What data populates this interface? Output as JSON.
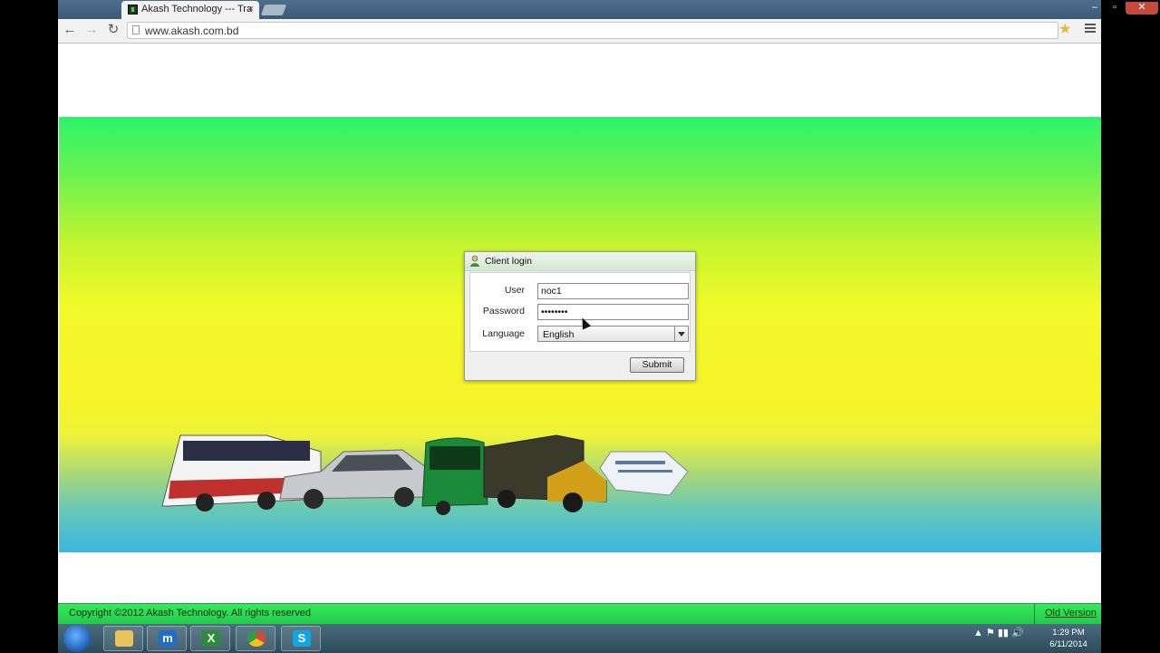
{
  "browser": {
    "tab_title": "Akash Technology --- Tra",
    "tab_close": "×",
    "url": "www.akash.com.bd",
    "window_controls": {
      "minimize": "–",
      "maximize": "▫",
      "close": "✕"
    },
    "nav": {
      "back": "←",
      "forward": "→",
      "reload": "↻"
    },
    "star": "★"
  },
  "login": {
    "title": "Client login",
    "user_label": "User",
    "user_value": "noc1",
    "password_label": "Password",
    "password_value": "••••••••",
    "language_label": "Language",
    "language_value": "English",
    "submit_label": "Submit"
  },
  "footer": {
    "copyright": "Copyright ©2012 Akash Technology. All rights reserved",
    "old_version": "Old Version"
  },
  "taskbar": {
    "apps": [
      {
        "name": "file-explorer",
        "glyph": "",
        "color": "#e8c25a"
      },
      {
        "name": "maxthon",
        "glyph": "m",
        "color": "#1f6fc8"
      },
      {
        "name": "excel",
        "glyph": "X",
        "color": "#2e8b3c"
      },
      {
        "name": "chrome",
        "glyph": "",
        "color": "#d8463a"
      },
      {
        "name": "skype",
        "glyph": "S",
        "color": "#12a5e6"
      }
    ],
    "tray_icons": "▲  ⚑  ▮▮  🔊",
    "time": "1:29 PM",
    "date": "6/11/2014"
  }
}
